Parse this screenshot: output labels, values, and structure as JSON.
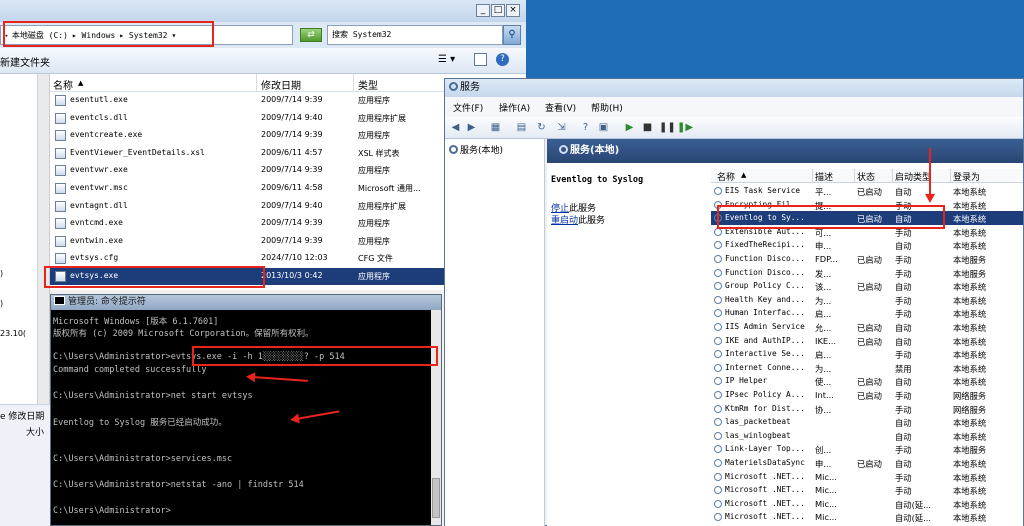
{
  "explorer": {
    "address": {
      "prefix": "→",
      "segments": [
        "本地磁盘 (C:)",
        "▸ Windows",
        "▸ System32"
      ],
      "dropdown": "▾"
    },
    "search_placeholder": "搜索 System32",
    "toolbar": {
      "new_folder": "新建文件夹"
    },
    "nav_fragments": [
      ")",
      ")",
      "23.10("
    ],
    "details": {
      "modified_label": "e 修改日期",
      "size_label": "大小"
    },
    "columns": {
      "name": "名称",
      "modified": "修改日期",
      "type": "类型"
    },
    "files": [
      {
        "name": "esentutl.exe",
        "date": "2009/7/14 9:39",
        "type": "应用程序"
      },
      {
        "name": "eventcls.dll",
        "date": "2009/7/14 9:40",
        "type": "应用程序扩展"
      },
      {
        "name": "eventcreate.exe",
        "date": "2009/7/14 9:39",
        "type": "应用程序"
      },
      {
        "name": "EventViewer_EventDetails.xsl",
        "date": "2009/6/11 4:57",
        "type": "XSL 样式表"
      },
      {
        "name": "eventvwr.exe",
        "date": "2009/7/14 9:39",
        "type": "应用程序"
      },
      {
        "name": "eventvwr.msc",
        "date": "2009/6/11 4:58",
        "type": "Microsoft 通用..."
      },
      {
        "name": "evntagnt.dll",
        "date": "2009/7/14 9:40",
        "type": "应用程序扩展"
      },
      {
        "name": "evntcmd.exe",
        "date": "2009/7/14 9:39",
        "type": "应用程序"
      },
      {
        "name": "evntwin.exe",
        "date": "2009/7/14 9:39",
        "type": "应用程序"
      },
      {
        "name": "evtsys.cfg",
        "date": "2024/7/10 12:03",
        "type": "CFG 文件"
      },
      {
        "name": "evtsys.exe",
        "date": "2013/10/3 0:42",
        "type": "应用程序"
      }
    ]
  },
  "cmd": {
    "title": "管理员: 命令提示符",
    "lines": [
      "Microsoft Windows [版本 6.1.7601]",
      "版权所有 (c) 2009 Microsoft Corporation。保留所有权利。",
      "C:\\Users\\Administrator>evtsys.exe -i -h 1░░░░░░░░? -p 514",
      "Command completed successfully",
      "C:\\Users\\Administrator>net start evtsys",
      "Eventlog to Syslog 服务已经启动成功。",
      "C:\\Users\\Administrator>services.msc",
      "C:\\Users\\Administrator>netstat -ano | findstr 514",
      "C:\\Users\\Administrator>"
    ]
  },
  "services": {
    "title": "服务",
    "menu": [
      "文件(F)",
      "操作(A)",
      "查看(V)",
      "帮助(H)"
    ],
    "tree_item": "服务(本地)",
    "header": "服务(本地)",
    "selected_service": "Eventlog to Syslog",
    "stop_link": "停止",
    "stop_rest": "此服务",
    "restart_link": "重启动",
    "restart_rest": "此服务",
    "columns": {
      "name": "名称",
      "desc": "描述",
      "status": "状态",
      "startup": "启动类型",
      "logon": "登录为"
    },
    "rows": [
      {
        "name": "EIS Task Service",
        "desc": "平...",
        "status": "已启动",
        "startup": "自动",
        "logon": "本地系统"
      },
      {
        "name": "Encrypting Fil...",
        "desc": "提...",
        "status": "",
        "startup": "手动",
        "logon": "本地系统"
      },
      {
        "name": "Eventlog to Sy...",
        "desc": "",
        "status": "已启动",
        "startup": "自动",
        "logon": "本地系统"
      },
      {
        "name": "Extensible Aut...",
        "desc": "可...",
        "status": "",
        "startup": "手动",
        "logon": "本地系统"
      },
      {
        "name": "FixedTheRecipi...",
        "desc": "申...",
        "status": "",
        "startup": "自动",
        "logon": "本地系统"
      },
      {
        "name": "Function Disco...",
        "desc": "FDP...",
        "status": "已启动",
        "startup": "手动",
        "logon": "本地服务"
      },
      {
        "name": "Function Disco...",
        "desc": "发...",
        "status": "",
        "startup": "手动",
        "logon": "本地服务"
      },
      {
        "name": "Group Policy C...",
        "desc": "该...",
        "status": "已启动",
        "startup": "自动",
        "logon": "本地系统"
      },
      {
        "name": "Health Key and...",
        "desc": "为...",
        "status": "",
        "startup": "手动",
        "logon": "本地系统"
      },
      {
        "name": "Human Interfac...",
        "desc": "启...",
        "status": "",
        "startup": "手动",
        "logon": "本地系统"
      },
      {
        "name": "IIS Admin Service",
        "desc": "允...",
        "status": "已启动",
        "startup": "自动",
        "logon": "本地系统"
      },
      {
        "name": "IKE and AuthIP...",
        "desc": "IKE...",
        "status": "已启动",
        "startup": "自动",
        "logon": "本地系统"
      },
      {
        "name": "Interactive Se...",
        "desc": "启...",
        "status": "",
        "startup": "手动",
        "logon": "本地系统"
      },
      {
        "name": "Internet Conne...",
        "desc": "为...",
        "status": "",
        "startup": "禁用",
        "logon": "本地系统"
      },
      {
        "name": "IP Helper",
        "desc": "使...",
        "status": "已启动",
        "startup": "自动",
        "logon": "本地系统"
      },
      {
        "name": "IPsec Policy A...",
        "desc": "Int...",
        "status": "已启动",
        "startup": "手动",
        "logon": "网络服务"
      },
      {
        "name": "KtmRm for Dist...",
        "desc": "协...",
        "status": "",
        "startup": "手动",
        "logon": "网络服务"
      },
      {
        "name": "las_packetbeat",
        "desc": "",
        "status": "",
        "startup": "自动",
        "logon": "本地系统"
      },
      {
        "name": "las_winlogbeat",
        "desc": "",
        "status": "",
        "startup": "自动",
        "logon": "本地系统"
      },
      {
        "name": "Link-Layer Top...",
        "desc": "创...",
        "status": "",
        "startup": "手动",
        "logon": "本地服务"
      },
      {
        "name": "MaterielsDataSync",
        "desc": "申...",
        "status": "已启动",
        "startup": "自动",
        "logon": "本地系统"
      },
      {
        "name": "Microsoft .NET...",
        "desc": "Mic...",
        "status": "",
        "startup": "手动",
        "logon": "本地系统"
      },
      {
        "name": "Microsoft .NET...",
        "desc": "Mic...",
        "status": "",
        "startup": "手动",
        "logon": "本地系统"
      },
      {
        "name": "Microsoft .NET...",
        "desc": "Mic...",
        "status": "",
        "startup": "自动(延...",
        "logon": "本地系统"
      },
      {
        "name": "Microsoft .NET...",
        "desc": "Mic...",
        "status": "",
        "startup": "自动(延...",
        "logon": "本地系统"
      }
    ]
  },
  "colors": {
    "highlight": "#e8241d",
    "selection": "#1d3d7a",
    "desktop": "#1f6db5"
  }
}
